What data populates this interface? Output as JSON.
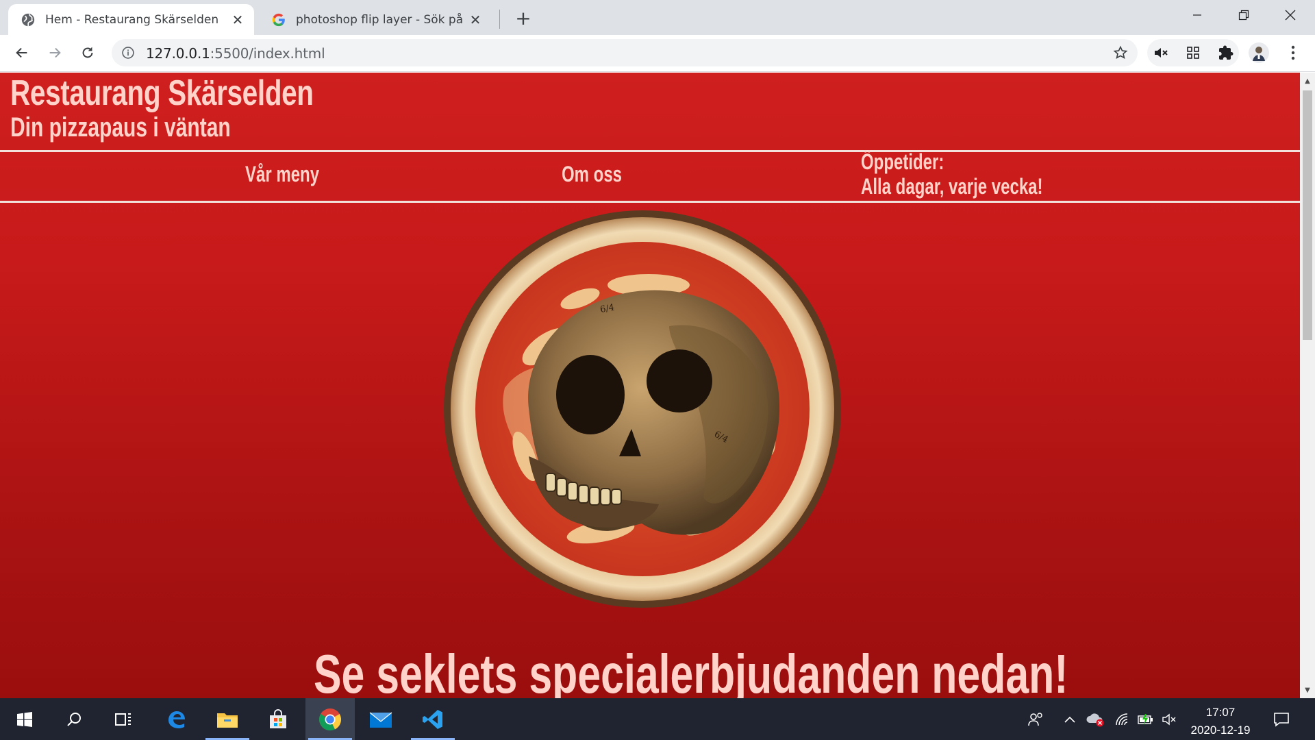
{
  "browser": {
    "tabs": [
      {
        "title": "Hem - Restaurang Skärselden",
        "icon": "globe-icon",
        "active": true
      },
      {
        "title": "photoshop flip layer - Sök på Goo",
        "icon": "google-icon",
        "active": false
      }
    ],
    "url_host": "127.0.0.1",
    "url_path": ":5500/index.html",
    "theme_color": "#dee1e6"
  },
  "page": {
    "site_title": "Restaurang Skärselden",
    "tagline": "Din pizzapaus i väntan",
    "nav": {
      "menu": "Vår meny",
      "about": "Om oss",
      "hours_label": "Öppetider:",
      "hours_value": "Alla dagar, varje vecka!"
    },
    "hero_image": "skull-pizza-image",
    "headline": "Se seklets specialerbjudanden nedan!",
    "colors": {
      "background": "#c81a1a",
      "text": "#ffd3c9",
      "rule": "#f3e1dc"
    }
  },
  "taskbar": {
    "apps": [
      "windows-start-icon",
      "search-icon",
      "task-view-icon",
      "edge-icon",
      "file-explorer-icon",
      "store-icon",
      "chrome-icon",
      "mail-icon",
      "vscode-icon"
    ],
    "active_app": "chrome-icon",
    "time": "17:07",
    "date": "2020-12-19"
  }
}
